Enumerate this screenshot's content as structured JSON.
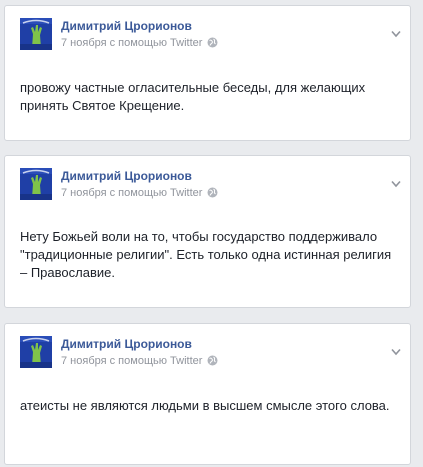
{
  "colors": {
    "background": "#e9ebee",
    "card": "#ffffff",
    "author_link": "#3b5998",
    "meta_text": "#90949c",
    "body_text": "#1d2129",
    "avatar_bg": "#1f3fa6"
  },
  "posts": [
    {
      "author": "Димитрий Црорионов",
      "meta": "7 ноября с помощью Twitter",
      "privacy_icon": "globe-icon",
      "menu_icon": "chevron-down-icon",
      "text": "провожу частные огласительные беседы, для желающих принять Святое Крещение."
    },
    {
      "author": "Димитрий Црорионов",
      "meta": "7 ноября с помощью Twitter",
      "privacy_icon": "globe-icon",
      "menu_icon": "chevron-down-icon",
      "text": "Нету Божьей воли на то, чтобы государство поддерживало \"традиционные религии\". Есть только одна истинная религия – Православие."
    },
    {
      "author": "Димитрий Црорионов",
      "meta": "7 ноября с помощью Twitter",
      "privacy_icon": "globe-icon",
      "menu_icon": "chevron-down-icon",
      "text": "атеисты не являются людьми в высшем смысле этого слова."
    }
  ]
}
